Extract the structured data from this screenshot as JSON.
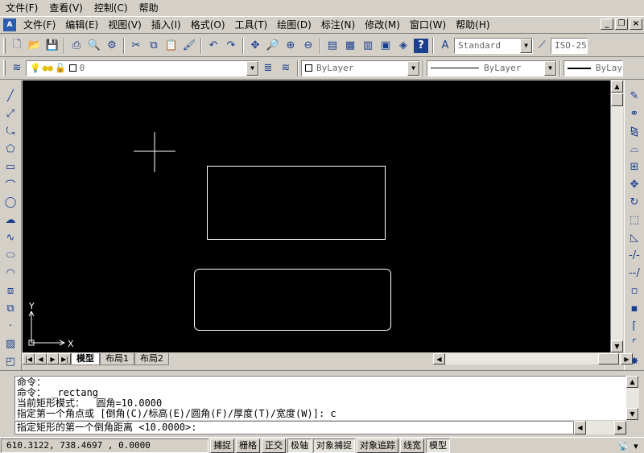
{
  "app_menu": [
    "文件(F)",
    "查看(V)",
    "控制(C)",
    "帮助"
  ],
  "doc_menu": [
    "文件(F)",
    "编辑(E)",
    "视图(V)",
    "插入(I)",
    "格式(O)",
    "工具(T)",
    "绘图(D)",
    "标注(N)",
    "修改(M)",
    "窗口(W)",
    "帮助(H)"
  ],
  "toolbar": {
    "text_style": "Standard",
    "dim_style": "ISO-25",
    "layer_value": "0",
    "color": "ByLayer",
    "linetype": "ByLayer",
    "lineweight": "ByLay"
  },
  "ucs": {
    "x_label": "X",
    "y_label": "Y"
  },
  "layout_tabs": [
    "模型",
    "布局1",
    "布局2"
  ],
  "command_history": [
    "命令：",
    "命令： _rectang",
    "当前矩形模式：  圆角=10.0000",
    "指定第一个角点或 [倒角(C)/标高(E)/圆角(F)/厚度(T)/宽度(W)]: c"
  ],
  "command_prompt": "指定矩形的第一个倒角距离 <10.0000>:",
  "status": {
    "coords": "610.3122,  738.4697 , 0.0000",
    "toggles": [
      {
        "label": "捕捉",
        "on": false
      },
      {
        "label": "栅格",
        "on": false
      },
      {
        "label": "正交",
        "on": false
      },
      {
        "label": "极轴",
        "on": true
      },
      {
        "label": "对象捕捉",
        "on": true
      },
      {
        "label": "对象追踪",
        "on": false
      },
      {
        "label": "线宽",
        "on": false
      },
      {
        "label": "模型",
        "on": true
      }
    ]
  },
  "colors": {
    "canvas": "#000000",
    "entities": "#ffffff",
    "chrome": "#d4d0c8"
  }
}
